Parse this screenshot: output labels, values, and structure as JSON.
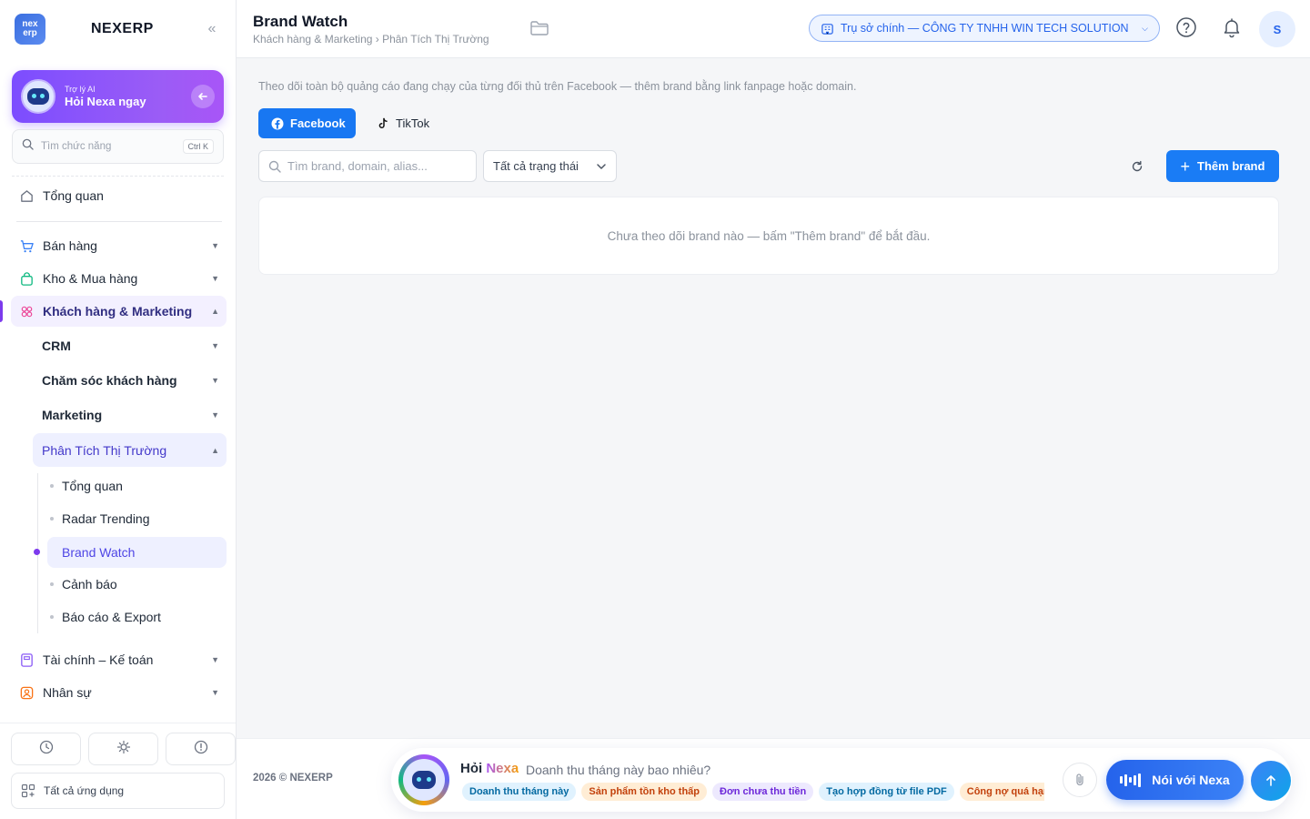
{
  "sidebar": {
    "logo_top": "nex",
    "logo_bottom": "erp",
    "brand": "NEXERP",
    "collapse_glyph": "«",
    "ai_card": {
      "subtitle": "Trợ lý AI",
      "title": "Hỏi Nexa ngay"
    },
    "search": {
      "placeholder": "Tìm chức năng",
      "shortcut": "Ctrl K"
    },
    "overview": "Tổng quan",
    "groups": [
      {
        "label": "Bán hàng",
        "icon": "cart-icon"
      },
      {
        "label": "Kho & Mua hàng",
        "icon": "bag-icon"
      },
      {
        "label": "Khách hàng & Marketing",
        "icon": "users-icon"
      }
    ],
    "subgroups": [
      {
        "label": "CRM"
      },
      {
        "label": "Chăm sóc khách hàng"
      },
      {
        "label": "Marketing"
      },
      {
        "label": "Phân Tích Thị Trường"
      }
    ],
    "leaves": [
      {
        "label": "Tổng quan"
      },
      {
        "label": "Radar Trending"
      },
      {
        "label": "Brand Watch"
      },
      {
        "label": "Cảnh báo"
      },
      {
        "label": "Báo cáo & Export"
      }
    ],
    "more_groups": [
      {
        "label": "Tài chính – Kế toán",
        "icon": "calculator-icon"
      },
      {
        "label": "Nhân sự",
        "icon": "person-icon"
      }
    ],
    "all_apps": "Tất cả ứng dụng"
  },
  "header": {
    "title": "Brand Watch",
    "breadcrumb": "Khách hàng & Marketing › Phân Tích Thị Trường",
    "company": "Trụ sở chính — CÔNG TY TNHH WIN TECH SOLUTION",
    "avatar_initial": "S"
  },
  "main": {
    "description": "Theo dõi toàn bộ quảng cáo đang chạy của từng đối thủ trên Facebook — thêm brand bằng link fanpage hoặc domain.",
    "tabs": [
      {
        "label": "Facebook"
      },
      {
        "label": "TikTok"
      }
    ],
    "search_placeholder": "Tìm brand, domain, alias...",
    "status_filter": "Tất cả trạng thái",
    "add_brand": "Thêm brand",
    "empty_text": "Chưa theo dõi brand nào — bấm \"Thêm brand\" để bắt đầu."
  },
  "footer": {
    "copyright": "2026 © NEXERP",
    "ask_prefix": "Hỏi",
    "ask_name": "Nexa",
    "question": "Doanh thu tháng này bao nhiêu?",
    "chips": [
      {
        "label": "Doanh thu tháng này",
        "bg": "#e0f2fe",
        "fg": "#0369a1"
      },
      {
        "label": "Sản phẩm tồn kho thấp",
        "bg": "#ffedd5",
        "fg": "#c2410c"
      },
      {
        "label": "Đơn chưa thu tiền",
        "bg": "#ede9fe",
        "fg": "#6d28d9"
      },
      {
        "label": "Tạo hợp đồng từ file PDF",
        "bg": "#e0f2fe",
        "fg": "#0369a1"
      },
      {
        "label": "Công nợ quá hạn",
        "bg": "#ffedd5",
        "fg": "#c2410c"
      }
    ],
    "talk": "Nói với Nexa"
  },
  "colors": {
    "primary": "#1a7cf5",
    "facebook": "#1877f2",
    "accent": "#7c3aed"
  }
}
